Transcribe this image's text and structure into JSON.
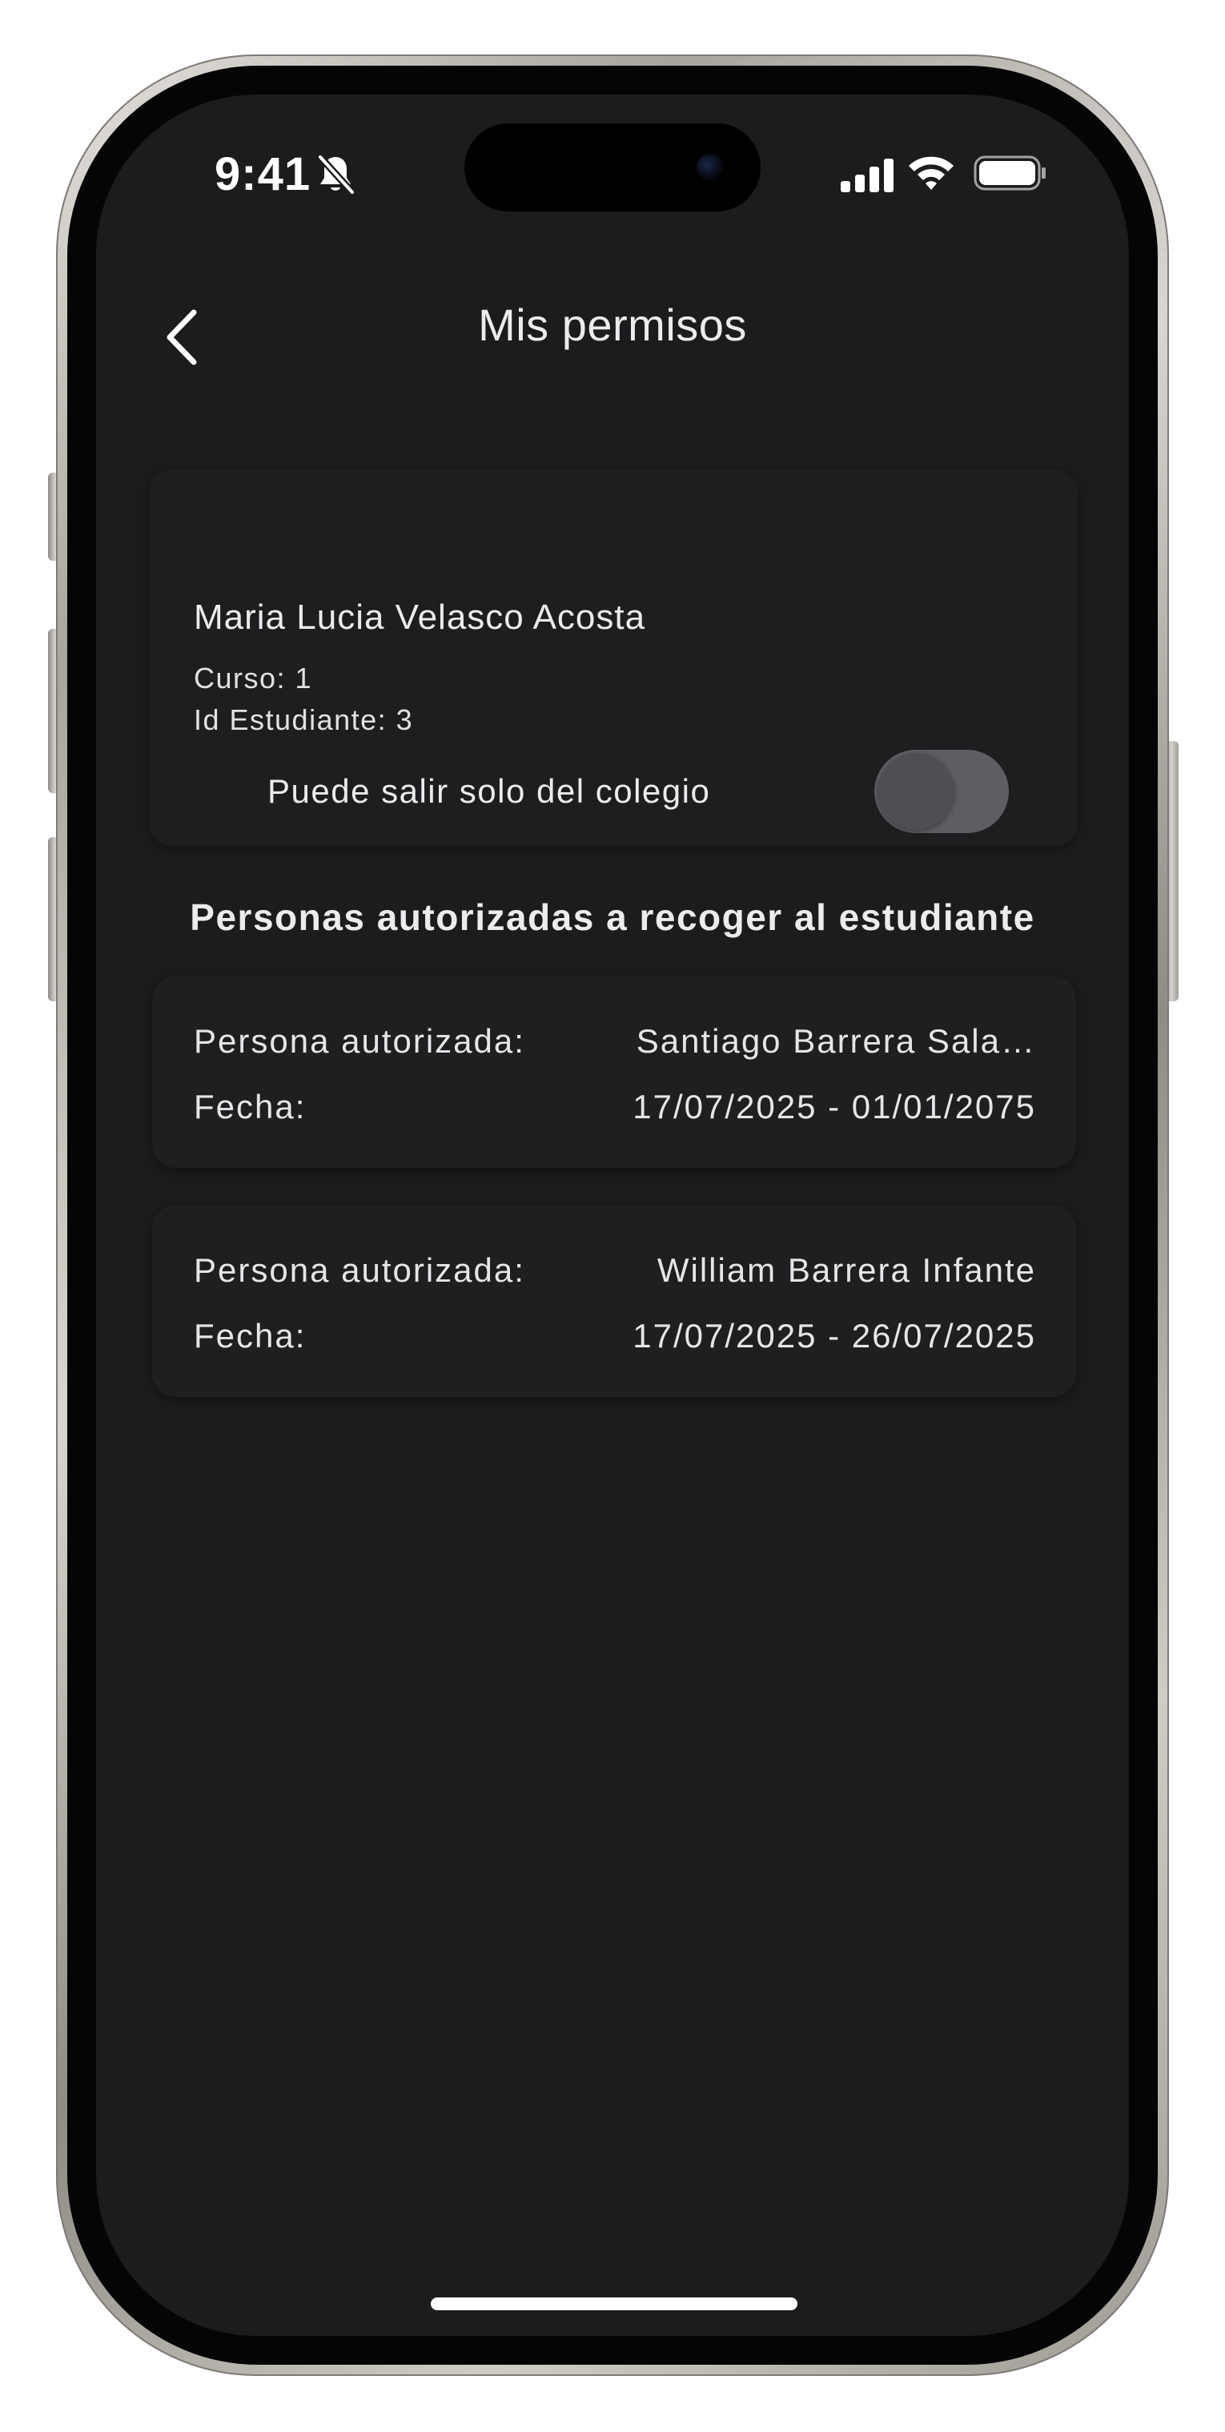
{
  "status_bar": {
    "time": "9:41",
    "icons": [
      "bell-slash-icon",
      "signal-icon",
      "wifi-icon",
      "battery-icon"
    ]
  },
  "header": {
    "title": "Mis permisos",
    "back_icon": "chevron-left-icon"
  },
  "student": {
    "name": "Maria Lucia Velasco Acosta",
    "course": "Curso: 1",
    "student_id": "Id Estudiante: 3",
    "toggle_label": "Puede salir solo del colegio",
    "toggle_on": false
  },
  "authorized": {
    "section_title": "Personas autorizadas a recoger al estudiante",
    "label_person": "Persona autorizada:",
    "label_date": "Fecha:",
    "people": [
      {
        "name": "Santiago Barrera Sala…",
        "date": "17/07/2025 - 01/01/2075"
      },
      {
        "name": "William Barrera Infante",
        "date": "17/07/2025 - 26/07/2025"
      }
    ]
  },
  "colors": {
    "background": "#1c1c1e",
    "card": "#1e1e20",
    "text": "#ececef",
    "toggle_track": "#5e5e62"
  }
}
